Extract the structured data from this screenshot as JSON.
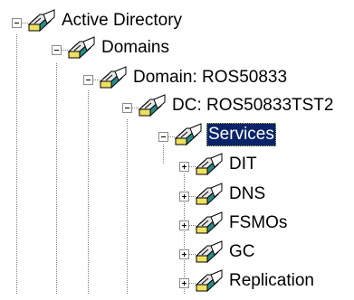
{
  "tree": {
    "nodes": [
      {
        "label": "Active Directory",
        "level": 0,
        "expander": "expanded",
        "selected": false,
        "icon": "folder-gear-icon"
      },
      {
        "label": "Domains",
        "level": 1,
        "expander": "expanded",
        "selected": false,
        "icon": "folder-gear-icon"
      },
      {
        "label": "Domain: ROS50833",
        "level": 2,
        "expander": "expanded",
        "selected": false,
        "icon": "folder-gear-icon"
      },
      {
        "label": "DC: ROS50833TST2",
        "level": 3,
        "expander": "expanded",
        "selected": false,
        "icon": "folder-gear-icon"
      },
      {
        "label": "Services",
        "level": 4,
        "expander": "expanded",
        "selected": true,
        "icon": "folder-gear-icon"
      },
      {
        "label": "DIT",
        "level": 5,
        "expander": "collapsed",
        "selected": false,
        "icon": "folder-gear-icon"
      },
      {
        "label": "DNS",
        "level": 5,
        "expander": "collapsed",
        "selected": false,
        "icon": "folder-gear-icon"
      },
      {
        "label": "FSMOs",
        "level": 5,
        "expander": "collapsed",
        "selected": false,
        "icon": "folder-gear-icon"
      },
      {
        "label": "GC",
        "level": 5,
        "expander": "collapsed",
        "selected": false,
        "icon": "folder-gear-icon"
      },
      {
        "label": "Replication",
        "level": 5,
        "expander": "collapsed",
        "selected": false,
        "icon": "folder-gear-icon"
      }
    ]
  },
  "colors": {
    "selection_bg": "#0a246a",
    "selection_text": "#ffffff",
    "icon_folder": "#e6e6e6",
    "icon_gear_front": "#f0e060",
    "icon_gear_side": "#2a8a8a"
  }
}
